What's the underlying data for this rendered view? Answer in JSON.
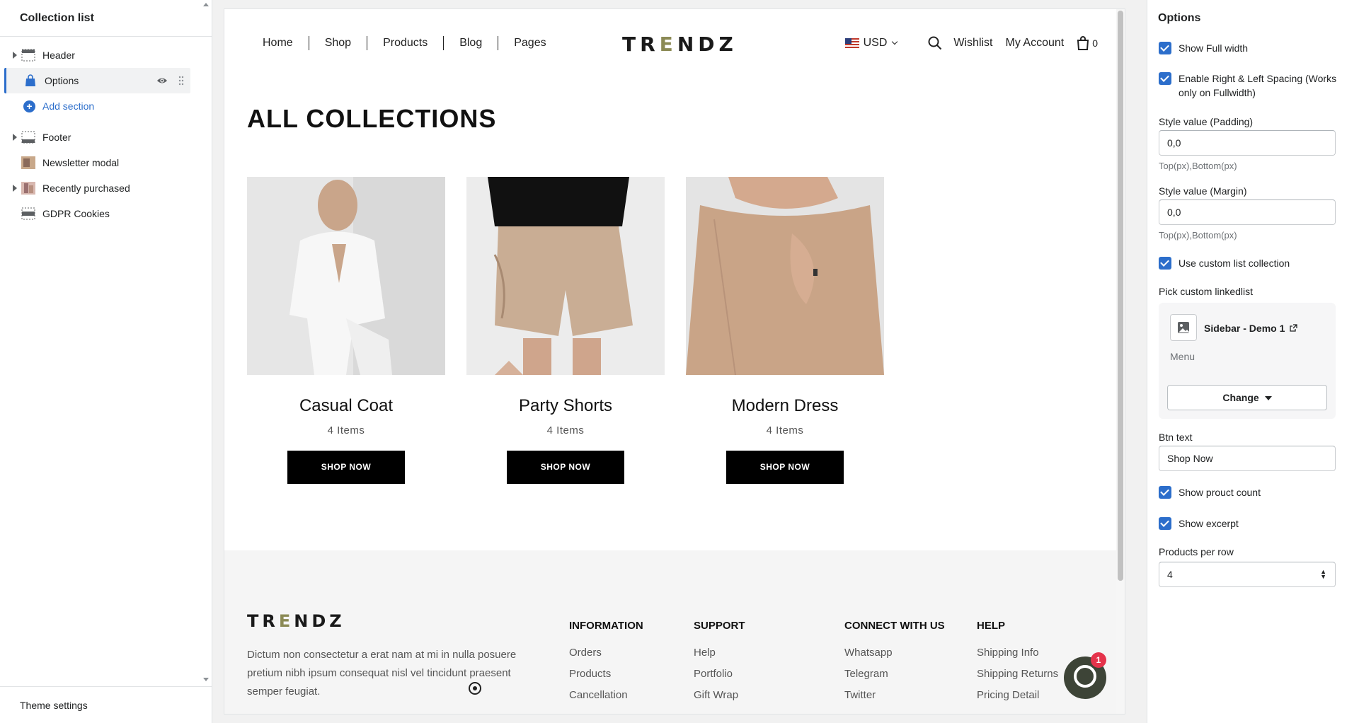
{
  "left_panel": {
    "title": "Collection list",
    "items": [
      {
        "label": "Header"
      },
      {
        "label": "Options"
      },
      {
        "label": "Add section"
      },
      {
        "label": "Footer"
      },
      {
        "label": "Newsletter modal"
      },
      {
        "label": "Recently purchased"
      },
      {
        "label": "GDPR Cookies"
      }
    ],
    "bottom": "Theme settings"
  },
  "store": {
    "nav": [
      "Home",
      "Shop",
      "Products",
      "Blog",
      "Pages"
    ],
    "logo": "TRENDZ",
    "currency": "USD",
    "wishlist": "Wishlist",
    "account": "My Account",
    "cart_count": "0",
    "heading": "ALL COLLECTIONS",
    "collections": [
      {
        "name": "Casual Coat",
        "count": "4 Items",
        "button": "SHOP NOW"
      },
      {
        "name": "Party Shorts",
        "count": "4 Items",
        "button": "SHOP NOW"
      },
      {
        "name": "Modern Dress",
        "count": "4 Items",
        "button": "SHOP NOW"
      }
    ],
    "footer": {
      "logo": "TRENDZ",
      "description": "Dictum non consectetur a erat nam at mi in nulla posuere pretium nibh ipsum consequat nisl vel tincidunt praesent semper feugiat.",
      "columns": [
        {
          "heading": "INFORMATION",
          "links": [
            "Orders",
            "Products",
            "Cancellation"
          ]
        },
        {
          "heading": "SUPPORT",
          "links": [
            "Help",
            "Portfolio",
            "Gift Wrap"
          ]
        },
        {
          "heading": "CONNECT WITH US",
          "links": [
            "Whatsapp",
            "Telegram",
            "Twitter"
          ]
        },
        {
          "heading": "HELP",
          "links": [
            "Shipping Info",
            "Shipping Returns",
            "Pricing Detail"
          ]
        }
      ],
      "chat_badge": "1"
    }
  },
  "right_panel": {
    "title": "Options",
    "show_full_width": "Show Full width",
    "enable_spacing": "Enable Right & Left Spacing (Works only on Fullwidth)",
    "padding_label": "Style value (Padding)",
    "padding_value": "0,0",
    "padding_hint": "Top(px),Bottom(px)",
    "margin_label": "Style value (Margin)",
    "margin_value": "0,0",
    "margin_hint": "Top(px),Bottom(px)",
    "use_custom": "Use custom list collection",
    "pick_label": "Pick custom linkedlist",
    "linkedlist_name": "Sidebar - Demo 1",
    "linkedlist_type": "Menu",
    "change_btn": "Change",
    "btn_text_label": "Btn text",
    "btn_text_value": "Shop Now",
    "show_count": "Show prouct count",
    "show_excerpt": "Show excerpt",
    "per_row_label": "Products per row",
    "per_row_value": "4"
  },
  "colors": {
    "accent": "#2c6ecb",
    "logo_accent": "#8b8a55",
    "chat_bg": "#3d4437",
    "badge": "#e5334b"
  }
}
